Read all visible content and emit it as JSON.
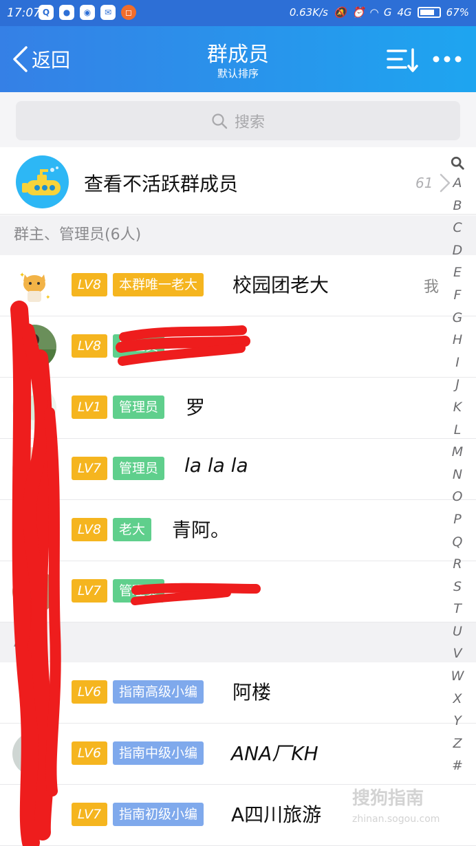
{
  "status_bar": {
    "time": "17:07",
    "net_speed": "0.63K/s",
    "signal1": "G",
    "signal2": "4G",
    "battery": "67%",
    "battery_level": 0.67
  },
  "header": {
    "back_label": "返回",
    "title": "群成员",
    "subtitle": "默认排序"
  },
  "search": {
    "placeholder": "搜索"
  },
  "inactive_row": {
    "label": "查看不活跃群成员",
    "count": "61"
  },
  "sections": [
    {
      "header": "群主、管理员(6人)"
    },
    {
      "header": "A"
    }
  ],
  "members": [
    {
      "level": "LV8",
      "tag": "本群唯一老大",
      "tag_color": "#f5b51f",
      "name": "校园团老大",
      "me": "我"
    },
    {
      "level": "LV8",
      "tag": "管理员",
      "tag_color": "#5fcf8c",
      "name": ""
    },
    {
      "level": "LV1",
      "tag": "管理员",
      "tag_color": "#5fcf8c",
      "name": "罗"
    },
    {
      "level": "LV7",
      "tag": "管理员",
      "tag_color": "#5fcf8c",
      "name": "la la la"
    },
    {
      "level": "LV8",
      "tag": "老大",
      "tag_color": "#5fcf8c",
      "name": "青阿。"
    },
    {
      "level": "LV7",
      "tag": "管理员",
      "tag_color": "#5fcf8c",
      "name": ""
    },
    {
      "level": "LV6",
      "tag": "指南高级小编",
      "tag_color": "#7fa9ec",
      "name": "阿楼"
    },
    {
      "level": "LV6",
      "tag": "指南中级小编",
      "tag_color": "#7fa9ec",
      "name": "ANA厂KH"
    },
    {
      "level": "LV7",
      "tag": "指南初级小编",
      "tag_color": "#7fa9ec",
      "name": "A四川旅游"
    }
  ],
  "index_letters": [
    "A",
    "B",
    "C",
    "D",
    "E",
    "F",
    "G",
    "H",
    "I",
    "J",
    "K",
    "L",
    "M",
    "N",
    "O",
    "P",
    "Q",
    "R",
    "S",
    "T",
    "U",
    "V",
    "W",
    "X",
    "Y",
    "Z",
    "#"
  ],
  "watermark": {
    "brand": "搜狗指南",
    "url": "zhinan.sogou.com"
  }
}
